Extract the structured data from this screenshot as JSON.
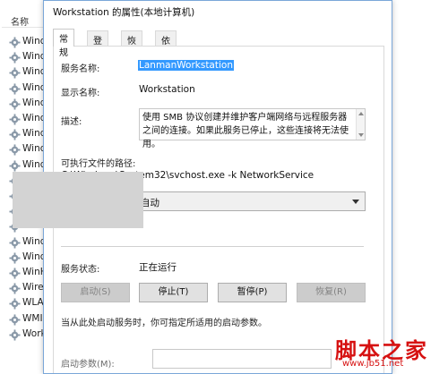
{
  "service_list": {
    "column_header": "名称",
    "rows": [
      "Wind",
      "Wind",
      "Wind",
      "Wind",
      "Wind",
      "Wind",
      "Wind",
      "Wind",
      "Wind",
      "Wind",
      "Wind",
      "Wind",
      "Wind",
      "Wind",
      "Wind",
      "WinH",
      "Wired",
      "WLAI",
      "WMI",
      "Work"
    ]
  },
  "dialog": {
    "title": "Workstation 的属性(本地计算机)",
    "tabs": [
      {
        "label": "常规",
        "active": true
      },
      {
        "label": "登录",
        "active": false
      },
      {
        "label": "恢复",
        "active": false
      },
      {
        "label": "依存关系",
        "active": false
      }
    ],
    "general": {
      "service_name_label": "服务名称:",
      "service_name_value": "LanmanWorkstation",
      "display_name_label": "显示名称:",
      "display_name_value": "Workstation",
      "description_label": "描述:",
      "description_value": "使用 SMB 协议创建并维护客户端网络与远程服务器之间的连接。如果此服务已停止，这些连接将无法使用。",
      "exe_path_label": "可执行文件的路径:",
      "exe_path_value": "C:\\Windows\\System32\\svchost.exe -k NetworkService",
      "startup_type_value": "自动",
      "status_label": "服务状态:",
      "status_value": "正在运行",
      "buttons": {
        "start": "启动(S)",
        "stop": "停止(T)",
        "pause": "暂停(P)",
        "resume": "恢复(R)"
      },
      "hint": "当从此处启动服务时，你可指定所适用的启动参数。",
      "start_params_label": "启动参数(M):"
    }
  },
  "watermark": {
    "text": "脚本之家",
    "url": "www.jb51.net"
  },
  "colors": {
    "selection": "#3399ff",
    "watermark": "#d61111",
    "window_border": "#7aa7d9"
  }
}
